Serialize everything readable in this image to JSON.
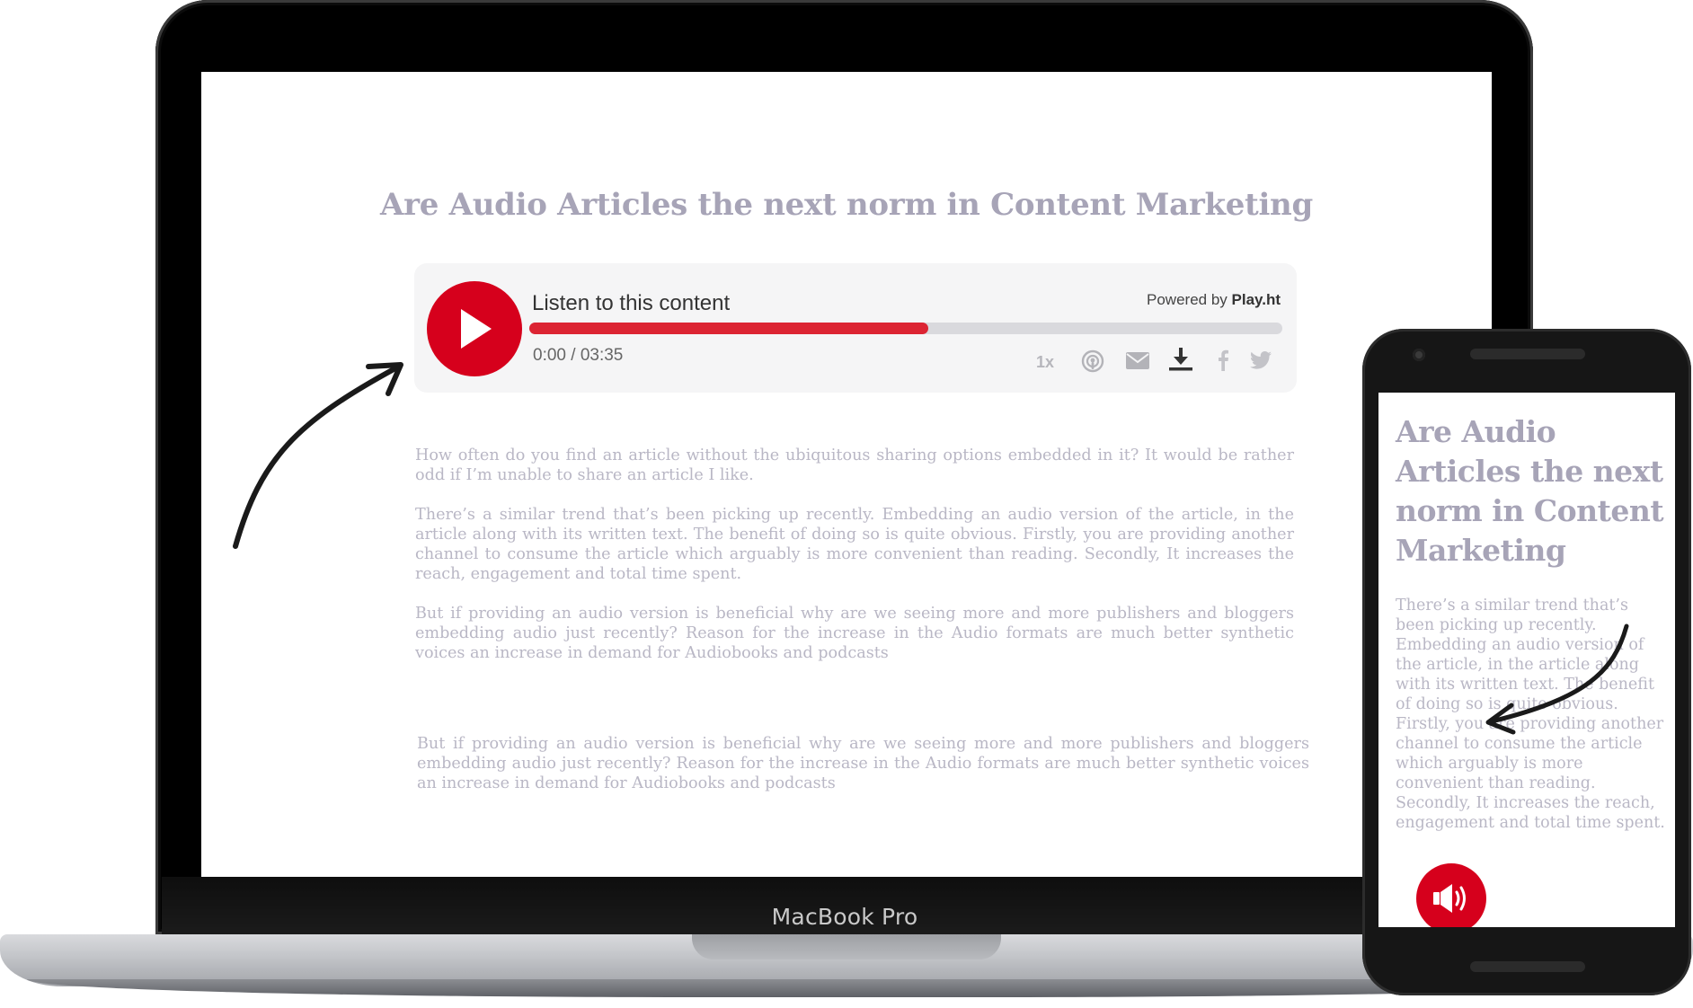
{
  "laptop": {
    "brand_label": "MacBook Pro",
    "article": {
      "title": "Are Audio Articles the next norm in Content Marketing",
      "paragraphs": [
        "How often do you find an article without the ubiquitous sharing options embedded in it? It would be rather odd if I’m unable to share an article I like.",
        "There’s a similar trend that’s been picking up recently. Embedding an audio version of the article, in the article along with its written text. The benefit of doing so is quite obvious. Firstly, you are providing another channel to consume the article which arguably is more convenient than reading. Secondly, It increases the reach, engagement and total time spent.",
        "But if providing an audio version is beneficial why are we seeing more and more publishers and bloggers embedding audio just recently? Reason for the increase in the Audio formats are much better synthetic voices an increase in demand for Audiobooks and podcasts",
        "But if providing an audio version is beneficial why are we seeing more and more publishers and bloggers embedding audio just recently? Reason for the increase in the Audio formats are much better synthetic voices an increase in demand for Audiobooks and podcasts"
      ]
    },
    "player": {
      "listen_label": "Listen to this content",
      "powered_prefix": "Powered by ",
      "powered_brand": "Play.ht",
      "time": "0:00 / 03:35",
      "progress_fraction": 0.53,
      "speed": "1x",
      "controls": [
        "play-icon",
        "podcast-icon",
        "email-icon",
        "download-icon",
        "facebook-icon",
        "twitter-icon"
      ]
    }
  },
  "phone": {
    "article": {
      "title": "Are Audio Articles the next norm in Content Marketing",
      "paragraph": "There’s a similar trend that’s been picking up recently. Embedding an audio version of the article, in the article along with its written text. The benefit of doing so is quite obvious. Firstly, you are providing another channel to consume the article which arguably is more convenient than reading. Secondly, It increases the reach, engagement and total time spent."
    },
    "audio_button_icon": "speaker-icon"
  },
  "colors": {
    "accent_red": "#d6001c",
    "progress_fill": "#dc2433",
    "title_text": "#a7a4b7",
    "body_text": "#b9b7c5"
  }
}
